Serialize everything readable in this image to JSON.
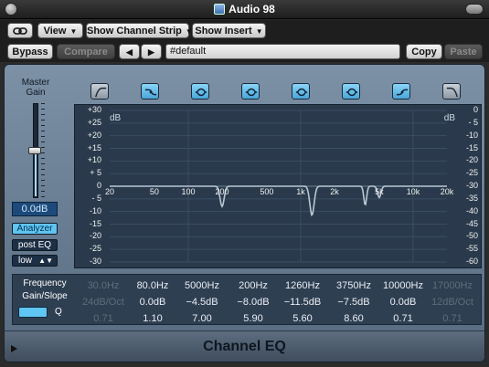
{
  "window": {
    "title": "Audio 98"
  },
  "toolbar1": {
    "link_icon": "link-icon",
    "view_label": "View",
    "show_channel_strip_label": "Show Channel Strip",
    "show_insert_label": "Show Insert"
  },
  "toolbar2": {
    "bypass_label": "Bypass",
    "compare_label": "Compare",
    "prev_arrow": "◀",
    "next_arrow": "▶",
    "preset_value": "#default",
    "copy_label": "Copy",
    "paste_label": "Paste"
  },
  "master": {
    "label_line1": "Master",
    "label_line2": "Gain",
    "gain_value": "0.0dB",
    "gain_level_fraction": 0.5,
    "analyzer_label": "Analyzer",
    "post_eq_label": "post EQ",
    "low_label": "low"
  },
  "graph": {
    "left_unit": "dB",
    "right_unit": "dB",
    "left_ticks": [
      "+30",
      "+25",
      "+20",
      "+15",
      "+10",
      "+ 5",
      "0",
      "- 5",
      "-10",
      "-15",
      "-20",
      "-25",
      "-30"
    ],
    "right_ticks": [
      "0",
      "- 5",
      "-10",
      "-15",
      "-20",
      "-25",
      "-30",
      "-35",
      "-40",
      "-45",
      "-50",
      "-55",
      "-60"
    ],
    "freq_labels": [
      "20",
      "50",
      "100",
      "200",
      "500",
      "1k",
      "2k",
      "5k",
      "10k",
      "20k"
    ]
  },
  "bands": [
    {
      "type": "low-cut-icon",
      "on": false
    },
    {
      "type": "low-shelf-icon",
      "on": true
    },
    {
      "type": "bell-icon",
      "on": true
    },
    {
      "type": "bell-icon",
      "on": true
    },
    {
      "type": "bell-icon",
      "on": true
    },
    {
      "type": "bell-icon",
      "on": true
    },
    {
      "type": "high-shelf-icon",
      "on": true
    },
    {
      "type": "high-cut-icon",
      "on": false
    }
  ],
  "params": {
    "frequency_label": "Frequency",
    "gain_slope_label": "Gain/Slope",
    "q_label": "Q",
    "columns": [
      {
        "freq": "30.0Hz",
        "gain": "24dB/Oct",
        "q": "0.71",
        "active": false
      },
      {
        "freq": "80.0Hz",
        "gain": "0.0dB",
        "q": "1.10",
        "active": true
      },
      {
        "freq": "5000Hz",
        "gain": "−4.5dB",
        "q": "7.00",
        "active": true
      },
      {
        "freq": "200Hz",
        "gain": "−8.0dB",
        "q": "5.90",
        "active": true
      },
      {
        "freq": "1260Hz",
        "gain": "−11.5dB",
        "q": "5.60",
        "active": true
      },
      {
        "freq": "3750Hz",
        "gain": "−7.5dB",
        "q": "8.60",
        "active": true
      },
      {
        "freq": "10000Hz",
        "gain": "0.0dB",
        "q": "0.71",
        "active": true
      },
      {
        "freq": "17000Hz",
        "gain": "12dB/Oct",
        "q": "0.71",
        "active": false
      }
    ]
  },
  "footer": {
    "plugin_name": "Channel EQ"
  }
}
